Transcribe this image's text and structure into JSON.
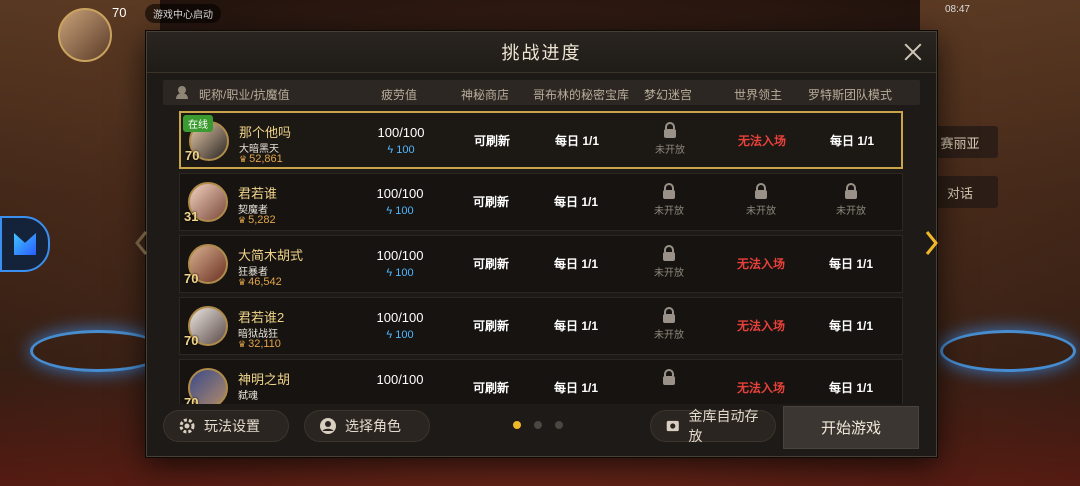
{
  "modal": {
    "title": "挑战进度",
    "columns": [
      "昵称/职业/抗魔值",
      "疲劳值",
      "神秘商店",
      "哥布林的秘密宝库",
      "梦幻迷宫",
      "世界领主",
      "罗特斯团队模式"
    ]
  },
  "hud": {
    "level": "70",
    "tag": "游戏中心启动",
    "time": "08:47",
    "menu_1": "赛丽亚",
    "menu_2": "对话"
  },
  "rows": [
    {
      "online": "在线",
      "level": "70",
      "name": "那个他吗",
      "job": "大暗黑天",
      "power": "52,861",
      "fatigue": "100/100",
      "energy": "100",
      "shop": "可刷新",
      "goblin": "每日 1/1",
      "maze": "未开放",
      "lord": "无法入场",
      "rotus": "每日 1/1"
    },
    {
      "online": "",
      "level": "31",
      "name": "君若谁",
      "job": "契魔者",
      "power": "5,282",
      "fatigue": "100/100",
      "energy": "100",
      "shop": "可刷新",
      "goblin": "每日 1/1",
      "maze": "未开放",
      "lord": "未开放",
      "rotus": "未开放"
    },
    {
      "online": "",
      "level": "70",
      "name": "大简木胡式",
      "job": "狂暴者",
      "power": "46,542",
      "fatigue": "100/100",
      "energy": "100",
      "shop": "可刷新",
      "goblin": "每日 1/1",
      "maze": "未开放",
      "lord": "无法入场",
      "rotus": "每日 1/1"
    },
    {
      "online": "",
      "level": "70",
      "name": "君若谁2",
      "job": "暗狱战狂",
      "power": "32,110",
      "fatigue": "100/100",
      "energy": "100",
      "shop": "可刷新",
      "goblin": "每日 1/1",
      "maze": "未开放",
      "lord": "无法入场",
      "rotus": "每日 1/1"
    },
    {
      "online": "",
      "level": "70",
      "name": "神明之胡",
      "job": "弑魂",
      "power": "",
      "fatigue": "100/100",
      "energy": "",
      "shop": "可刷新",
      "goblin": "每日 1/1",
      "maze": "",
      "lord": "无法入场",
      "rotus": "每日 1/1"
    }
  ],
  "footer": {
    "settings_label": "玩法设置",
    "character_label": "选择角色",
    "auto_store_label": "金库自动存放",
    "start_label": "开始游戏",
    "page_count": 3,
    "current_page": 1
  },
  "colors": {
    "accent_gold": "#c9a54a",
    "blocked_red": "#e8413a",
    "energy_blue": "#4fb7ff",
    "active_dot": "#f0b828"
  },
  "icons": [
    "close-icon",
    "lock-icon",
    "lightning-icon",
    "crown-icon",
    "gear-icon",
    "character-icon",
    "vault-icon",
    "chevron-left-icon",
    "chevron-right-icon"
  ]
}
